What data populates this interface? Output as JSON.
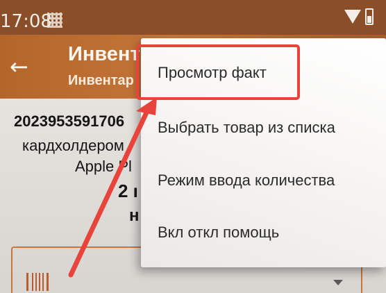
{
  "status_bar": {
    "time": "17:08",
    "icons": [
      "qr-code-icon",
      "wifi-icon",
      "battery-icon"
    ]
  },
  "app_bar": {
    "back_icon": "back-arrow-icon",
    "title": "Инвент",
    "subtitle": "Инвентар"
  },
  "content": {
    "barcode": "2023953591706",
    "item_name_line1": "кардхолдером",
    "item_name_line2": "Apple Pl",
    "quantity": "2 ı",
    "unit": "н",
    "input_icon": "barcode-scan-icon",
    "dropdown_icon": "chevron-down-icon"
  },
  "menu": {
    "items": [
      {
        "label": "Просмотр факт"
      },
      {
        "label": "Выбрать товар из списка"
      },
      {
        "label": "Режим ввода количества"
      },
      {
        "label": "Вкл откл помощь"
      }
    ]
  },
  "colors": {
    "status_bar": "#8a4f28",
    "app_bar": "#b3652a",
    "accent": "#c8763c",
    "annotation": "#e8443c"
  }
}
